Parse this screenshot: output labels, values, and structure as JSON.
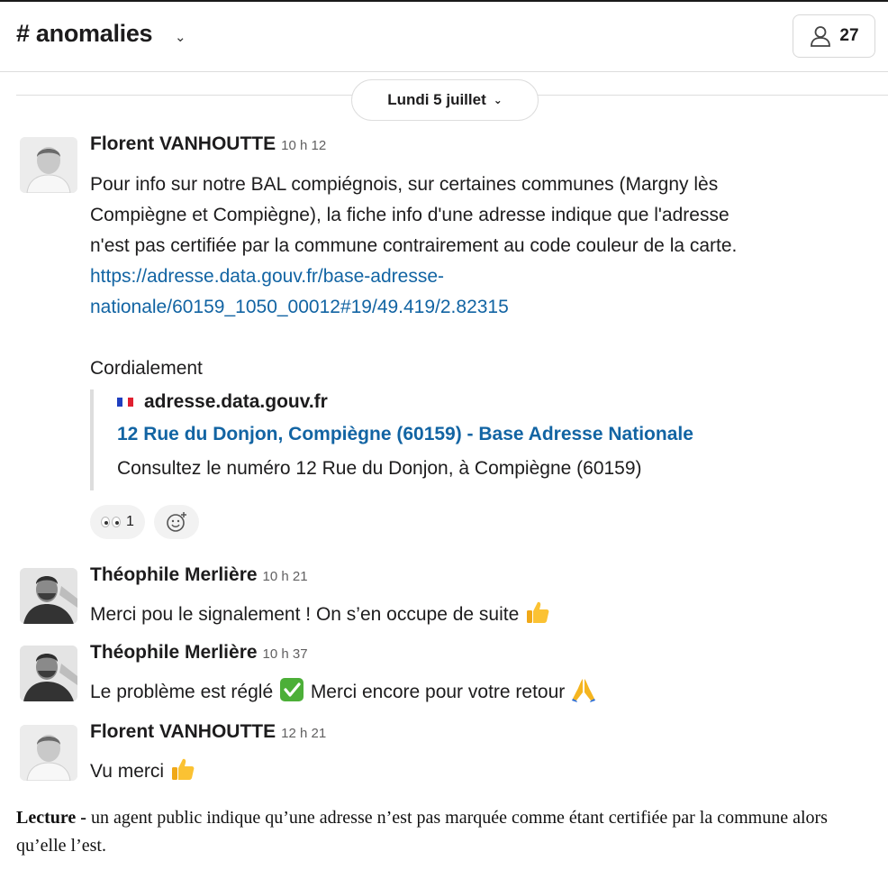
{
  "channel": {
    "name": "# anomalies",
    "member_count": "27"
  },
  "date_divider": "Lundi 5 juillet",
  "messages": [
    {
      "author": "Florent VANHOUTTE",
      "time": "10 h 12",
      "lines": [
        "Pour info sur notre BAL compiégnois, sur certaines communes (Margny lès",
        "Compiègne et Compiègne), la fiche info d'une adresse indique que l'adresse",
        "n'est pas certifiée par la commune contrairement au code couleur de la carte."
      ],
      "link_lines": [
        "https://adresse.data.gouv.fr/base-adresse-",
        "nationale/60159_1050_00012#19/49.419/2.82315"
      ],
      "signoff": "Cordialement",
      "unfurl": {
        "site": "adresse.data.gouv.fr",
        "title": "12 Rue du Donjon, Compiègne (60159) - Base Adresse Nationale",
        "description": "Consultez le numéro 12 Rue du Donjon, à Compiègne (60159)"
      },
      "reactions": [
        {
          "emoji": "eyes",
          "count": "1"
        }
      ]
    },
    {
      "author": "Théophile Merlière",
      "time": "10 h 21",
      "text": "Merci pou le signalement ! On s’en occupe de suite"
    },
    {
      "author": "Théophile Merlière",
      "time": "10 h 37",
      "text_before": "Le problème est réglé",
      "text_after": "Merci encore pour votre retour"
    },
    {
      "author": "Florent VANHOUTTE",
      "time": "12 h 21",
      "text": "Vu merci"
    }
  ],
  "caption": {
    "lead": "Lecture -",
    "text": " un agent public indique qu’une adresse n’est pas marquée comme étant certifiée par la commune alors qu’elle l’est."
  },
  "colors": {
    "link": "#1264a3",
    "divider": "#dddddd"
  }
}
